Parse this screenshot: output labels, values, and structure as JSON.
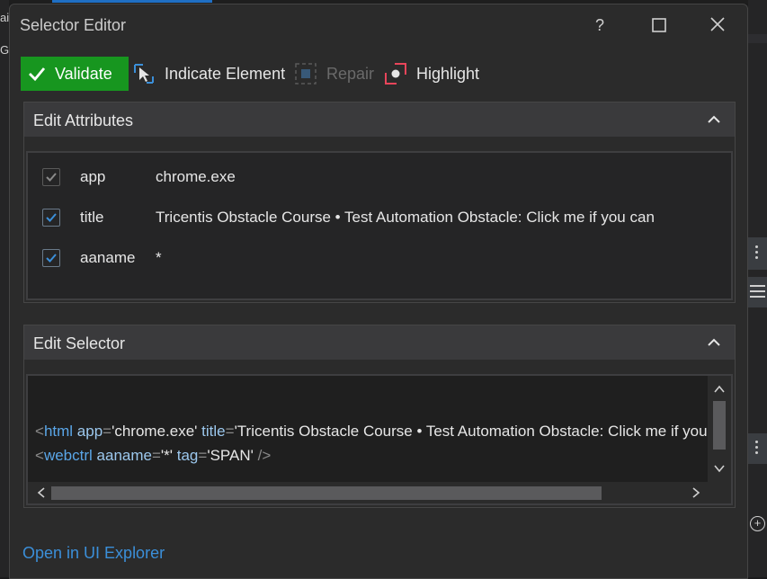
{
  "window": {
    "title": "Selector Editor",
    "help_label": "?"
  },
  "toolbar": {
    "validate_label": "Validate",
    "indicate_label": "Indicate Element",
    "repair_label": "Repair",
    "highlight_label": "Highlight",
    "validate_color": "#17961f"
  },
  "attributes_panel": {
    "title": "Edit Attributes",
    "rows": [
      {
        "checked": true,
        "enabled": false,
        "name": "app",
        "value": "chrome.exe"
      },
      {
        "checked": true,
        "enabled": true,
        "name": "title",
        "value": "Tricentis Obstacle Course • Test Automation Obstacle: Click me if you can"
      },
      {
        "checked": true,
        "enabled": true,
        "name": "aaname",
        "value": "*"
      }
    ]
  },
  "selector_panel": {
    "title": "Edit Selector",
    "line1": {
      "open": "<",
      "tag": "html",
      "attr1": "app",
      "eq1": "=",
      "val1": "'chrome.exe'",
      "attr2": "title",
      "eq2": "=",
      "val2": "'Tricentis Obstacle Course • Test Automation Obstacle: Click me if you can'"
    },
    "line2": {
      "open": "<",
      "tag": "webctrl",
      "attr1": "aaname",
      "eq1": "=",
      "val1": "'*'",
      "attr2": "tag",
      "eq2": "=",
      "val2": "'SPAN'",
      "close": "/>"
    }
  },
  "footer": {
    "link_label": "Open in UI Explorer"
  },
  "background": {
    "left_text_1": "ai",
    "left_text_2": "G"
  }
}
